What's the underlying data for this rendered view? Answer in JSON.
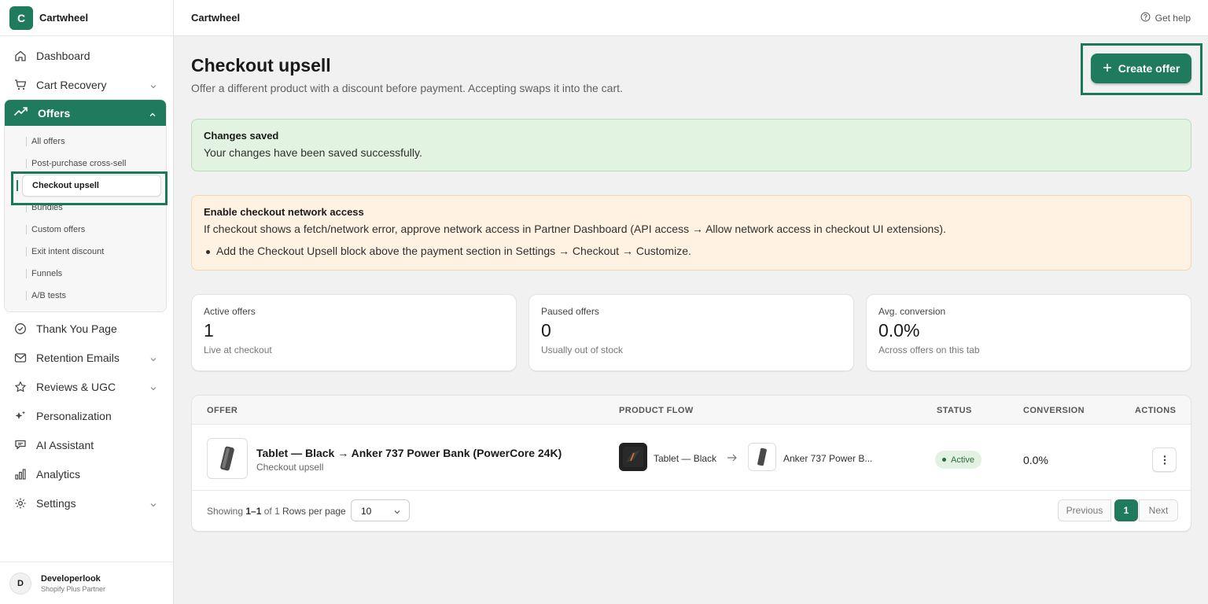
{
  "app": {
    "logo_letter": "C",
    "name": "Cartwheel",
    "accent": "#1f7a5e"
  },
  "topbar": {
    "title": "Cartwheel",
    "help_label": "Get help"
  },
  "sidebar": {
    "items_top": [
      {
        "label": "Dashboard",
        "icon": "home-icon"
      },
      {
        "label": "Cart Recovery",
        "icon": "cart-icon"
      }
    ],
    "offers": {
      "label": "Offers",
      "icon": "trending-up-icon",
      "children": [
        "All offers",
        "Post-purchase cross-sell",
        "Checkout upsell",
        "Bundles",
        "Custom offers",
        "Exit intent discount",
        "Funnels",
        "A/B tests"
      ],
      "active": "Checkout upsell"
    },
    "items_bottom": [
      {
        "label": "Thank You Page",
        "icon": "check-circle-icon"
      },
      {
        "label": "Retention Emails",
        "icon": "mail-icon"
      },
      {
        "label": "Reviews & UGC",
        "icon": "star-icon"
      },
      {
        "label": "Personalization",
        "icon": "sparkle-icon"
      },
      {
        "label": "AI Assistant",
        "icon": "chat-icon"
      },
      {
        "label": "Analytics",
        "icon": "bar-chart-icon"
      },
      {
        "label": "Settings",
        "icon": "gear-icon"
      }
    ],
    "user": {
      "initial": "D",
      "name": "Developerlook",
      "role": "Shopify Plus Partner"
    }
  },
  "page": {
    "title": "Checkout upsell",
    "subtitle": "Offer a different product with a discount before payment. Accepting swaps it into the cart.",
    "create_button": "Create offer"
  },
  "banners": {
    "success": {
      "title": "Changes saved",
      "text": "Your changes have been saved successfully."
    },
    "warning": {
      "title": "Enable checkout network access",
      "text": "If checkout shows a fetch/network error, approve network access in Partner Dashboard (API access → Allow network access in checkout UI extensions).",
      "bullet": "Add the Checkout Upsell block above the payment section in Settings → Checkout → Customize."
    }
  },
  "stats": [
    {
      "label": "Active offers",
      "value": "1",
      "hint": "Live at checkout"
    },
    {
      "label": "Paused offers",
      "value": "0",
      "hint": "Usually out of stock"
    },
    {
      "label": "Avg. conversion",
      "value": "0.0%",
      "hint": "Across offers on this tab"
    }
  ],
  "table": {
    "headers": [
      "OFFER",
      "PRODUCT FLOW",
      "STATUS",
      "CONVERSION",
      "ACTIONS"
    ],
    "rows": [
      {
        "name": "Tablet — Black → Anker 737 Power Bank (PowerCore 24K)",
        "type": "Checkout upsell",
        "from_product": "Tablet — Black",
        "to_product": "Anker 737 Power B...",
        "status": "Active",
        "conversion": "0.0%"
      }
    ],
    "footer": {
      "showing_prefix": "Showing",
      "showing_range": "1–1",
      "showing_suffix": "of 1",
      "rows_per_page_label": "Rows per page",
      "rows_per_page_value": "10",
      "prev": "Previous",
      "page": "1",
      "next": "Next"
    }
  }
}
